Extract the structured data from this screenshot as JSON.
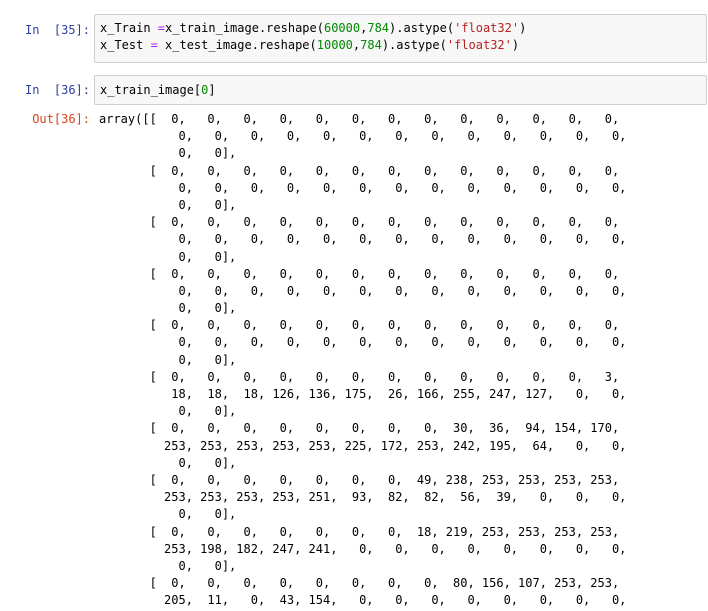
{
  "cells": [
    {
      "prompt": "In  [35]:",
      "lines": [
        [
          {
            "t": "x_Train ",
            "c": ""
          },
          {
            "t": "=",
            "c": "op"
          },
          {
            "t": "x_train_image.reshape(",
            "c": ""
          },
          {
            "t": "60000",
            "c": "num"
          },
          {
            "t": ",",
            "c": ""
          },
          {
            "t": "784",
            "c": "num"
          },
          {
            "t": ").astype(",
            "c": ""
          },
          {
            "t": "'float32'",
            "c": "str"
          },
          {
            "t": ")",
            "c": ""
          }
        ],
        [
          {
            "t": "x_Test ",
            "c": ""
          },
          {
            "t": "=",
            "c": "op"
          },
          {
            "t": " x_test_image.reshape(",
            "c": ""
          },
          {
            "t": "10000",
            "c": "num"
          },
          {
            "t": ",",
            "c": ""
          },
          {
            "t": "784",
            "c": "num"
          },
          {
            "t": ").astype(",
            "c": ""
          },
          {
            "t": "'float32'",
            "c": "str"
          },
          {
            "t": ")",
            "c": ""
          }
        ]
      ]
    },
    {
      "prompt": "In  [36]:",
      "lines": [
        [
          {
            "t": "x_train_image[",
            "c": ""
          },
          {
            "t": "0",
            "c": "num"
          },
          {
            "t": "]",
            "c": ""
          }
        ]
      ]
    }
  ],
  "output": {
    "prompt": "Out[36]:",
    "lines": [
      "array([[  0,   0,   0,   0,   0,   0,   0,   0,   0,   0,   0,   0,   0,",
      "           0,   0,   0,   0,   0,   0,   0,   0,   0,   0,   0,   0,   0,",
      "           0,   0],",
      "       [  0,   0,   0,   0,   0,   0,   0,   0,   0,   0,   0,   0,   0,",
      "           0,   0,   0,   0,   0,   0,   0,   0,   0,   0,   0,   0,   0,",
      "           0,   0],",
      "       [  0,   0,   0,   0,   0,   0,   0,   0,   0,   0,   0,   0,   0,",
      "           0,   0,   0,   0,   0,   0,   0,   0,   0,   0,   0,   0,   0,",
      "           0,   0],",
      "       [  0,   0,   0,   0,   0,   0,   0,   0,   0,   0,   0,   0,   0,",
      "           0,   0,   0,   0,   0,   0,   0,   0,   0,   0,   0,   0,   0,",
      "           0,   0],",
      "       [  0,   0,   0,   0,   0,   0,   0,   0,   0,   0,   0,   0,   0,",
      "           0,   0,   0,   0,   0,   0,   0,   0,   0,   0,   0,   0,   0,",
      "           0,   0],",
      "       [  0,   0,   0,   0,   0,   0,   0,   0,   0,   0,   0,   0,   3,",
      "          18,  18,  18, 126, 136, 175,  26, 166, 255, 247, 127,   0,   0,",
      "           0,   0],",
      "       [  0,   0,   0,   0,   0,   0,   0,   0,  30,  36,  94, 154, 170,",
      "         253, 253, 253, 253, 253, 225, 172, 253, 242, 195,  64,   0,   0,",
      "           0,   0],",
      "       [  0,   0,   0,   0,   0,   0,   0,  49, 238, 253, 253, 253, 253,",
      "         253, 253, 253, 253, 251,  93,  82,  82,  56,  39,   0,   0,   0,",
      "           0,   0],",
      "       [  0,   0,   0,   0,   0,   0,   0,  18, 219, 253, 253, 253, 253,",
      "         253, 198, 182, 247, 241,   0,   0,   0,   0,   0,   0,   0,   0,",
      "           0,   0],",
      "       [  0,   0,   0,   0,   0,   0,   0,   0,  80, 156, 107, 253, 253,",
      "         205,  11,   0,  43, 154,   0,   0,   0,   0,   0,   0,   0,   0,"
    ]
  }
}
